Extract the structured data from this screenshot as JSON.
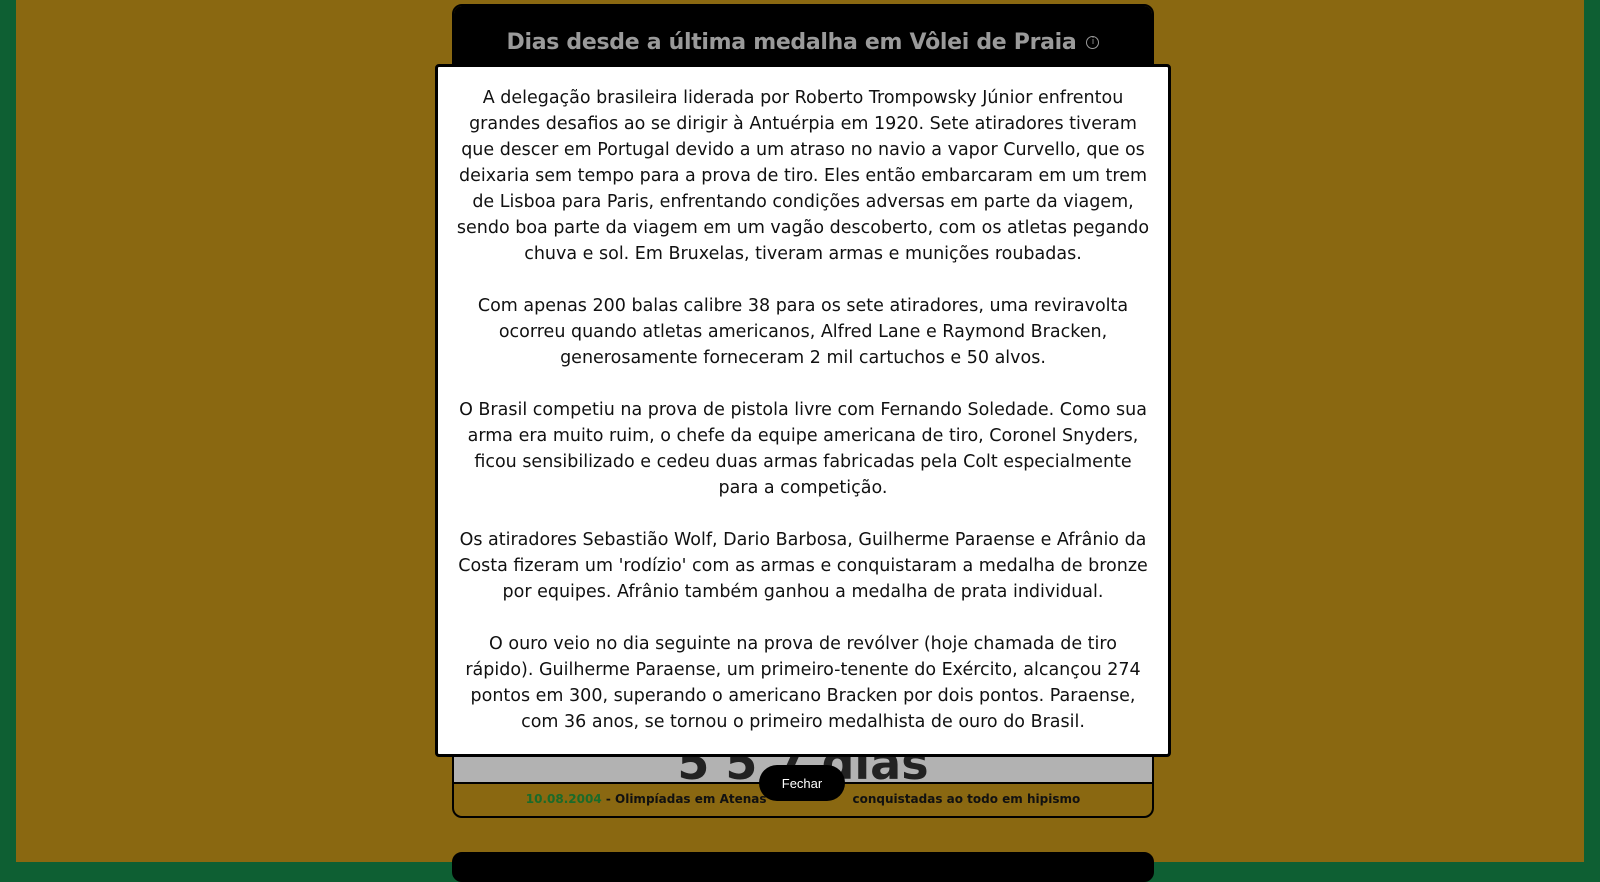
{
  "card": {
    "title": "Dias desde a última medalha em Vôlei de Praia",
    "info_icon": "info-circle-icon",
    "counter": "5 5 7 dias",
    "footer_date": "10.08.2004",
    "footer_text_left": " - Olimpíadas em Atenas",
    "footer_text_right": "conquistadas ao todo em hipismo"
  },
  "modal": {
    "paragraphs": [
      "A delegação brasileira liderada por Roberto Trompowsky Júnior enfrentou grandes desafios ao se dirigir à Antuérpia em 1920. Sete atiradores tiveram que descer em Portugal devido a um atraso no navio a vapor Curvello, que os deixaria sem tempo para a prova de tiro. Eles então embarcaram em um trem de Lisboa para Paris, enfrentando condições adversas em parte da viagem, sendo boa parte da viagem em um vagão descoberto, com os atletas pegando chuva e sol. Em Bruxelas, tiveram armas e munições roubadas.",
      "Com apenas 200 balas calibre 38 para os sete atiradores, uma reviravolta ocorreu quando atletas americanos, Alfred Lane e Raymond Bracken, generosamente forneceram 2 mil cartuchos e 50 alvos.",
      "O Brasil competiu na prova de pistola livre com Fernando Soledade. Como sua arma era muito ruim, o chefe da equipe americana de tiro, Coronel Snyders, ficou sensibilizado e cedeu duas armas fabricadas pela Colt especialmente para a competição.",
      "Os atiradores Sebastião Wolf, Dario Barbosa, Guilherme Paraense e Afrânio da Costa fizeram um 'rodízio' com as armas e conquistaram a medalha de bronze por equipes. Afrânio também ganhou a medalha de prata individual.",
      "O ouro veio no dia seguinte na prova de revólver (hoje chamada de tiro rápido). Guilherme Paraense, um primeiro-tenente do Exército, alcançou 274 pontos em 300, superando o americano Bracken por dois pontos. Paraense, com 36 anos, se tornou o primeiro medalhista de ouro do Brasil."
    ],
    "close_label": "Fechar"
  },
  "colors": {
    "page_background": "#8a6811",
    "edge_green": "#0e5f33",
    "header_black": "#000000",
    "title_gray": "#9a9a9a",
    "footer_date_green": "#1a6b2a"
  }
}
